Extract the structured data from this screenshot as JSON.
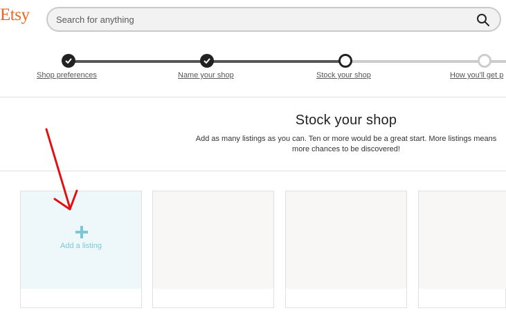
{
  "header": {
    "logo": "Etsy",
    "search_placeholder": "Search for anything"
  },
  "stepper": {
    "steps": [
      {
        "label": "Shop preferences",
        "state": "done"
      },
      {
        "label": "Name your shop",
        "state": "done"
      },
      {
        "label": "Stock your shop",
        "state": "current"
      },
      {
        "label": "How you'll get p",
        "state": "todo"
      }
    ]
  },
  "main": {
    "title": "Stock your shop",
    "subtitle_line1": "Add as many listings as you can. Ten or more would be a great start. More listings means",
    "subtitle_line2": "more chances to be discovered!",
    "add_listing_label": "Add a listing"
  },
  "colors": {
    "brand": "#F1641E",
    "add_card_tint": "#eef8fb",
    "add_accent": "#7ac8d7",
    "annotation_arrow": "#e41010"
  },
  "icons": [
    "search-icon",
    "check-icon",
    "plus-icon",
    "annotation-arrow"
  ]
}
